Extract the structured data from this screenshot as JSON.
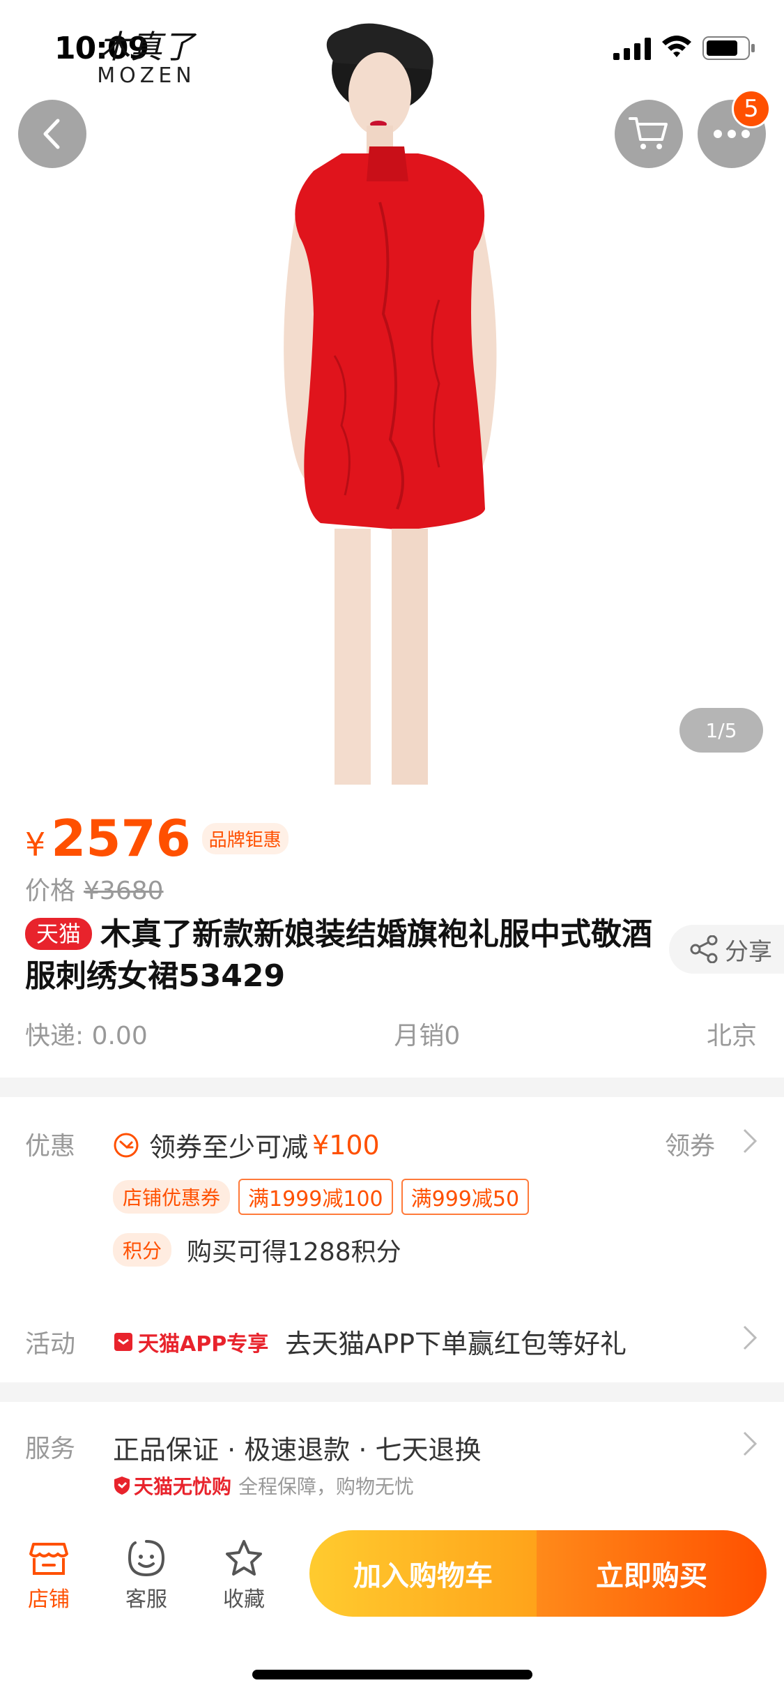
{
  "status_bar": {
    "time": "10:09",
    "brand_cn": "木真了",
    "brand_en": "MOZEN"
  },
  "gallery": {
    "counter": "1/5",
    "badge_count": "5"
  },
  "price": {
    "symbol": "¥",
    "value": "2576",
    "promo_label": "品牌钜惠",
    "original_label": "价格",
    "original_value": "¥3680"
  },
  "title": {
    "store_tag": "天猫",
    "text": "木真了新款新娘装结婚旗袍礼服中式敬酒服刺绣女裙53429",
    "share_label": "分享"
  },
  "meta": {
    "shipping": "快递: 0.00",
    "monthly_sales": "月销0",
    "location": "北京"
  },
  "discount": {
    "label": "优惠",
    "coupon_text": "领券至少可减",
    "coupon_amount": "¥100",
    "get_coupon": "领券",
    "store_coupon_tag": "店铺优惠券",
    "tickets": [
      "满1999减100",
      "满999减50"
    ],
    "points_tag": "积分",
    "points_text": "购买可得1288积分"
  },
  "activity": {
    "label": "活动",
    "tag": "天猫APP专享",
    "text": "去天猫APP下单赢红包等好礼"
  },
  "service": {
    "label": "服务",
    "text": "正品保证 · 极速退款 · 七天退换",
    "sub_tag": "天猫无忧购",
    "sub_text": "全程保障，购物无忧"
  },
  "bottom_bar": {
    "shop": "店铺",
    "customer_service": "客服",
    "favorite": "收藏",
    "add_to_cart": "加入购物车",
    "buy_now": "立即购买"
  },
  "colors": {
    "accent": "#ff5000",
    "tmall_red": "#e8232c",
    "cart_yellow": "#ffb01f"
  }
}
